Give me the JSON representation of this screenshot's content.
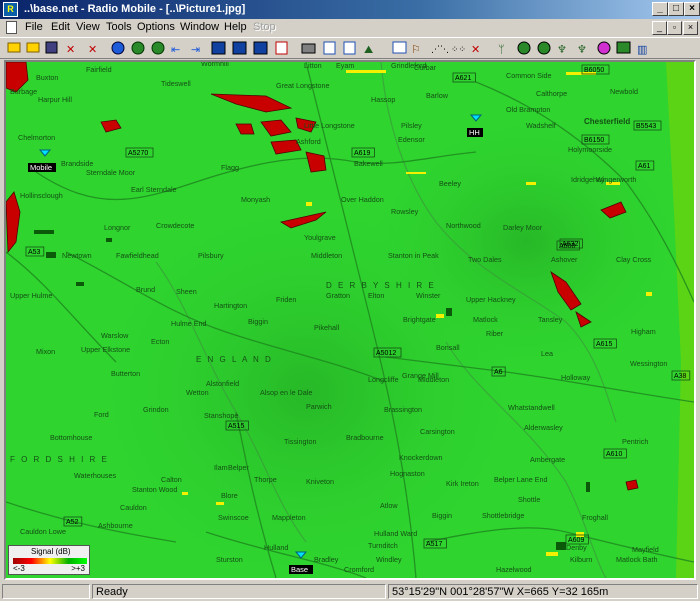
{
  "window": {
    "title": "..\\base.net - Radio Mobile - [..\\Picture1.jpg]",
    "app_icon": "radio-mobile-icon",
    "controls": [
      "minimize",
      "maximize",
      "close"
    ]
  },
  "menu": {
    "items": [
      "File",
      "Edit",
      "View",
      "Tools",
      "Options",
      "Window",
      "Help",
      "Stop"
    ],
    "disabled": [
      "Stop"
    ]
  },
  "toolbar": {
    "icons": [
      "open-folder-icon",
      "open-icon",
      "save-icon",
      "close-icon",
      "network-properties-icon",
      "unit-properties-icon",
      "world-icon",
      "map-properties-icon",
      "extract-map-icon",
      "merge-icon",
      "zoom-in-icon",
      "zoom-out-icon",
      "window-icon",
      "save-picture-icon",
      "copy-icon",
      "pdf-icon",
      "print-icon",
      "copy-picture-icon",
      "find-icon",
      "elevation-icon",
      "overlay-icon",
      "grid-icon",
      "points-icon",
      "cancel-icon",
      "radio-link-icon",
      "polar-coverage-icon",
      "cartesian-coverage-icon",
      "route-coverage-icon",
      "combine-icon",
      "spectrum-icon",
      "antenna-icon",
      "legend-icon"
    ]
  },
  "map": {
    "base_color": "#2ed22e",
    "place_labels": [
      "Buxton",
      "Fairfield",
      "Wormhill",
      "Litton",
      "Eyam",
      "Grindleford",
      "Curbar",
      "Barlow",
      "Common Side",
      "Burbage",
      "Harpur Hill",
      "Tideswell",
      "Great Longstone",
      "Little Longstone",
      "Hassop",
      "Pilsley",
      "Old Brampton",
      "Calthorpe",
      "Newbold",
      "Chelmorton",
      "Ashford",
      "Edensor",
      "Wadshelf",
      "Chesterfield",
      "Brandside",
      "Sterndale Moor",
      "Flagg",
      "Bakewell",
      "Beeley",
      "Holymoorside",
      "Hollinsclough",
      "Earl Sterndale",
      "Monyash",
      "Over Haddon",
      "Rowsley",
      "Wingerworth",
      "Longnor",
      "Crowdecote",
      "Youlgrave",
      "Northwood",
      "Darley Moor",
      "Newtown",
      "Fawfieldhead",
      "Pilsbury",
      "Middleton",
      "Stanton in Peak",
      "Two Dales",
      "Ashover",
      "Clay Cross",
      "Upper Hulme",
      "Brund",
      "Sheen",
      "Hartington",
      "Friden",
      "Gratton",
      "Elton",
      "Winster",
      "Upper Hackney",
      "Matlock",
      "Tansley",
      "Higham",
      "Warslow",
      "Hulme End",
      "Biggin",
      "Pikehall",
      "Brightgate",
      "Riber",
      "Upper Elkstone",
      "Ecton",
      "Mixon",
      "Butterton",
      "Alstonfield",
      "Bonsall",
      "Lea",
      "Holloway",
      "Wessington",
      "Longcliffe",
      "Grange Mill",
      "Middleton",
      "Wetton",
      "Alsop en le Dale",
      "Parwich",
      "Brassington",
      "Whatstandwell",
      "Ford",
      "Grindon",
      "Stanshope",
      "Tissington",
      "Carsington",
      "Alderwasley",
      "Bottomhouse",
      "Bradbourne",
      "Knockerdown",
      "Ambergate",
      "Pentrich",
      "Waterhouses",
      "Calton",
      "Ilam",
      "Thorpe",
      "Kniveton",
      "Hognaston",
      "Kirk Ireton",
      "Belper Lane End",
      "Shottle",
      "Blore",
      "Cauldon",
      "Swinscoe",
      "Mappleton",
      "Atlow",
      "Biggin",
      "Belper",
      "Froghall",
      "Cauldon Lowe",
      "Ashbourne",
      "Hulland",
      "Hulland Ward",
      "Turnditch",
      "Shottlebridge",
      "Denby",
      "Mayfield",
      "Sturston",
      "Bradley",
      "Windley",
      "Hazelwood",
      "Kilburn",
      "Matlock Bath",
      "Idridgehay",
      "Cromford",
      "Stanton Wood"
    ],
    "region_labels": [
      "ENGLAND",
      "D E R B Y S H I R E",
      "F O R D S H I R E"
    ],
    "road_labels": [
      "A6",
      "A53",
      "A515",
      "A5270",
      "A5012",
      "A517",
      "A52",
      "A608",
      "A609",
      "A610",
      "A615",
      "A619",
      "A621",
      "A632",
      "A61",
      "A38",
      "B6050",
      "B6150",
      "B5543"
    ],
    "units": [
      {
        "name": "Mobile",
        "icon": "unit-marker-icon"
      },
      {
        "name": "HH",
        "icon": "unit-marker-icon"
      },
      {
        "name": "Base",
        "icon": "unit-marker-icon"
      }
    ]
  },
  "legend": {
    "title": "Signal (dB)",
    "min_label": "<-3",
    "max_label": ">+3"
  },
  "status": {
    "state": "Ready",
    "position": "53°15'29\"N 001°28'57\"W  X=665 Y=32 165m"
  }
}
